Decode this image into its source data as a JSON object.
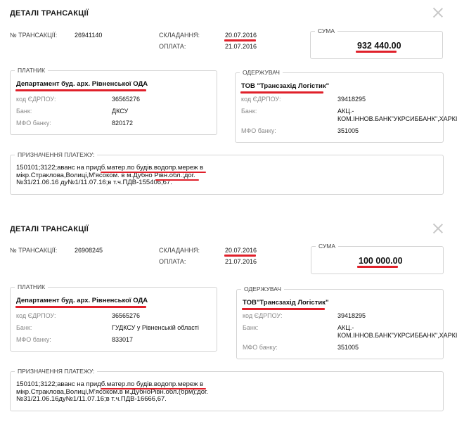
{
  "transactions": [
    {
      "title": "ДЕТАЛІ ТРАНСАКЦІЇ",
      "number_label": "№ ТРАНСАКЦІЇ:",
      "number": "26941140",
      "created_label": "СКЛАДАННЯ:",
      "created": "20.07.2016",
      "paid_label": "ОПЛАТА:",
      "paid": "21.07.2016",
      "sum_label": "СУМА",
      "sum": "932 440.00",
      "payer": {
        "legend": "ПЛАТНИК",
        "name": "Департамент буд. арх. Рівненської ОДА",
        "edrpou_label": "код ЄДРПОУ:",
        "edrpou": "36565276",
        "bank_label": "Банк:",
        "bank": "ДКСУ",
        "mfo_label": "МФО банку:",
        "mfo": "820172"
      },
      "recipient": {
        "legend": "ОДЕРЖУВАЧ",
        "name": "ТОВ \"Трансзахід Логістик\"",
        "edrpou_label": "код ЄДРПОУ:",
        "edrpou": "39418295",
        "bank_label": "Банк:",
        "bank_line1": "АКЦ.-",
        "bank_line2": "КОМ.ІННОВ.БАНК\"УКРСИББАНК\",ХАРКІВ",
        "mfo_label": "МФО банку:",
        "mfo": "351005"
      },
      "purpose_label": "ПРИЗНАЧЕННЯ ПЛАТЕЖУ:",
      "purpose_lines": [
        "150101;3122;аванс на придб.матер.по будів.водопр.мереж в",
        "мікр.Страклова,Волиці,М'ясоком. в м.Дубно Рівн.обл.;дог.",
        "№31/21.06.16 ду№1/11.07.16;в т.ч.ПДВ-155406,67."
      ]
    },
    {
      "title": "ДЕТАЛІ ТРАНСАКЦІЇ",
      "number_label": "№ ТРАНСАКЦІЇ:",
      "number": "26908245",
      "created_label": "СКЛАДАННЯ:",
      "created": "20.07.2016",
      "paid_label": "ОПЛАТА:",
      "paid": "21.07.2016",
      "sum_label": "СУМА",
      "sum": "100 000.00",
      "payer": {
        "legend": "ПЛАТНИК",
        "name": "Департамент буд. арх. Рівненської ОДА",
        "edrpou_label": "код ЄДРПОУ:",
        "edrpou": "36565276",
        "bank_label": "Банк:",
        "bank": "ГУДКСУ у Рівненській області",
        "mfo_label": "МФО банку:",
        "mfo": "833017"
      },
      "recipient": {
        "legend": "ОДЕРЖУВАЧ",
        "name": "ТОВ\"Трансзахід Логістик\"",
        "edrpou_label": "код ЄДРПОУ:",
        "edrpou": "39418295",
        "bank_label": "Банк:",
        "bank_line1": "АКЦ.-",
        "bank_line2": "КОМ.ІННОВ.БАНК\"УКРСИББАНК\",ХАРКІВ",
        "mfo_label": "МФО банку:",
        "mfo": "351005"
      },
      "purpose_label": "ПРИЗНАЧЕННЯ ПЛАТЕЖУ:",
      "purpose_lines": [
        "150101;3122;аванс на придб.матер.по будів.водопр.мереж в",
        "мікр.Страклова,Волиці,М'ясоком.в м.ДубноРівн.обл.(брм);дог.",
        "№31/21.06.16ду№1/11.07.16;в т.ч.ПДВ-16666,67."
      ]
    }
  ],
  "highlight_color": "#e0202a"
}
